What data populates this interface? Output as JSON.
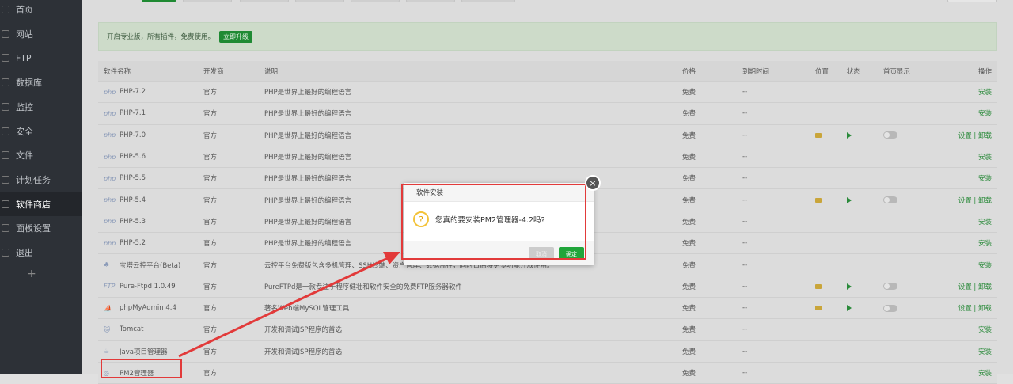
{
  "sidebar": {
    "items": [
      {
        "label": "首页",
        "icon": "home-icon"
      },
      {
        "label": "网站",
        "icon": "globe-icon"
      },
      {
        "label": "FTP",
        "icon": "user-icon"
      },
      {
        "label": "数据库",
        "icon": "database-icon"
      },
      {
        "label": "监控",
        "icon": "monitor-icon"
      },
      {
        "label": "安全",
        "icon": "shield-icon"
      },
      {
        "label": "文件",
        "icon": "folder-icon"
      },
      {
        "label": "计划任务",
        "icon": "clock-icon"
      },
      {
        "label": "软件商店",
        "icon": "grid-icon",
        "active": true
      },
      {
        "label": "面板设置",
        "icon": "gear-icon"
      },
      {
        "label": "退出",
        "icon": "logout-icon"
      }
    ],
    "add": "+"
  },
  "banner": {
    "text": "开启专业版，所有插件，免费使用。",
    "button": "立即升级"
  },
  "table": {
    "headers": [
      "软件名称",
      "开发商",
      "说明",
      "价格",
      "到期时间",
      "位置",
      "状态",
      "首页显示",
      "操作"
    ],
    "rows": [
      {
        "icon": "php",
        "name": "PHP-7.2",
        "dev": "官方",
        "desc": "PHP是世界上最好的编程语言",
        "price": "免费",
        "expire": "--",
        "installed": false,
        "action": "安装"
      },
      {
        "icon": "php",
        "name": "PHP-7.1",
        "dev": "官方",
        "desc": "PHP是世界上最好的编程语言",
        "price": "免费",
        "expire": "--",
        "installed": false,
        "action": "安装"
      },
      {
        "icon": "php",
        "name": "PHP-7.0",
        "dev": "官方",
        "desc": "PHP是世界上最好的编程语言",
        "price": "免费",
        "expire": "--",
        "installed": true,
        "action": "设置 | 卸载"
      },
      {
        "icon": "php",
        "name": "PHP-5.6",
        "dev": "官方",
        "desc": "PHP是世界上最好的编程语言",
        "price": "免费",
        "expire": "--",
        "installed": false,
        "action": "安装"
      },
      {
        "icon": "php",
        "name": "PHP-5.5",
        "dev": "官方",
        "desc": "PHP是世界上最好的编程语言",
        "price": "免费",
        "expire": "--",
        "installed": false,
        "action": "安装"
      },
      {
        "icon": "php",
        "name": "PHP-5.4",
        "dev": "官方",
        "desc": "PHP是世界上最好的编程语言",
        "price": "免费",
        "expire": "--",
        "installed": true,
        "action": "设置 | 卸载"
      },
      {
        "icon": "php",
        "name": "PHP-5.3",
        "dev": "官方",
        "desc": "PHP是世界上最好的编程语言",
        "price": "免费",
        "expire": "--",
        "installed": false,
        "action": "安装"
      },
      {
        "icon": "php",
        "name": "PHP-5.2",
        "dev": "官方",
        "desc": "PHP是世界上最好的编程语言",
        "price": "免费",
        "expire": "--",
        "installed": false,
        "action": "安装"
      },
      {
        "icon": "bt",
        "name": "宝塔云控平台(Beta)",
        "dev": "官方",
        "desc": "云控平台免费版包含多机管理、SSH终端、资产管理、数据监控，同时日后将更多功能开放使用。",
        "price": "免费",
        "expire": "--",
        "installed": false,
        "action": "安装"
      },
      {
        "icon": "ftp",
        "name": "Pure-Ftpd 1.0.49",
        "dev": "官方",
        "desc": "PureFTPd是一款专注于程序健壮和软件安全的免费FTP服务器软件",
        "price": "免费",
        "expire": "--",
        "installed": true,
        "action": "设置 | 卸载"
      },
      {
        "icon": "pma",
        "name": "phpMyAdmin 4.4",
        "dev": "官方",
        "desc": "著名Web端MySQL管理工具",
        "price": "免费",
        "expire": "--",
        "installed": true,
        "action": "设置 | 卸载"
      },
      {
        "icon": "tomcat",
        "name": "Tomcat",
        "dev": "官方",
        "desc": "开发和调试JSP程序的首选",
        "price": "免费",
        "expire": "--",
        "installed": false,
        "action": "安装"
      },
      {
        "icon": "java",
        "name": "Java项目管理器",
        "dev": "官方",
        "desc": "开发和调试JSP程序的首选",
        "price": "免费",
        "expire": "--",
        "installed": false,
        "action": "安装"
      },
      {
        "icon": "pm2",
        "name": "PM2管理器",
        "dev": "官方",
        "desc": "",
        "price": "免费",
        "expire": "--",
        "installed": false,
        "action": "安装"
      }
    ]
  },
  "dialog": {
    "title": "软件安装",
    "message": "您真的要安装PM2管理器-4.2吗?",
    "cancel": "取消",
    "ok": "确定",
    "close": "×"
  },
  "colors": {
    "accent": "#20a53a",
    "annotation": "#e23a3a"
  }
}
